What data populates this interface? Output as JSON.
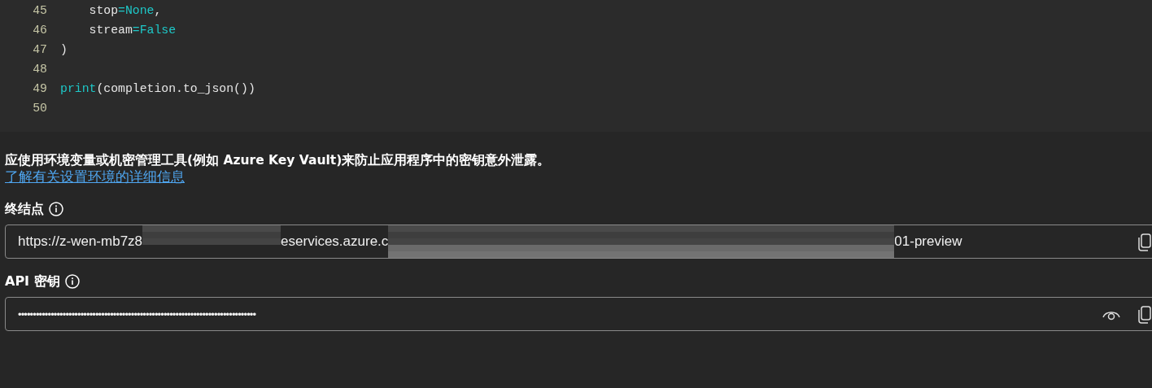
{
  "code": {
    "lines": [
      {
        "number": "45",
        "tokens": [
          {
            "kind": "plain",
            "text": "    stop"
          },
          {
            "kind": "keyword",
            "text": "=None"
          },
          {
            "kind": "plain",
            "text": ","
          }
        ]
      },
      {
        "number": "46",
        "tokens": [
          {
            "kind": "plain",
            "text": "    stream"
          },
          {
            "kind": "keyword",
            "text": "=False"
          }
        ]
      },
      {
        "number": "47",
        "tokens": [
          {
            "kind": "plain",
            "text": ")"
          }
        ]
      },
      {
        "number": "48"
      },
      {
        "number": "49",
        "tokens": [
          {
            "kind": "keyword",
            "text": "print"
          },
          {
            "kind": "plain",
            "text": "(completion.to_json())"
          }
        ]
      },
      {
        "number": "50"
      }
    ]
  },
  "notice": "应使用环境变量或机密管理工具(例如 Azure Key Vault)来防止应用程序中的密钥意外泄露。",
  "learn_more_link": "了解有关设置环境的详细信息",
  "fields": [
    {
      "label": "终结点",
      "kind": "endpoint",
      "segments": [
        {
          "kind": "text",
          "text": "https://z-wen-mb7z8"
        },
        {
          "kind": "redacted_short"
        },
        {
          "kind": "text",
          "text": "eservices.azure.c"
        },
        {
          "kind": "redacted_long"
        },
        {
          "kind": "text",
          "text": "01-preview"
        }
      ]
    },
    {
      "label": "API 密钥",
      "kind": "secret",
      "masked_value": "••••••••••••••••••••••••••••••••••••••••••••••••••••••••••••••••••••••••••••••••"
    }
  ]
}
